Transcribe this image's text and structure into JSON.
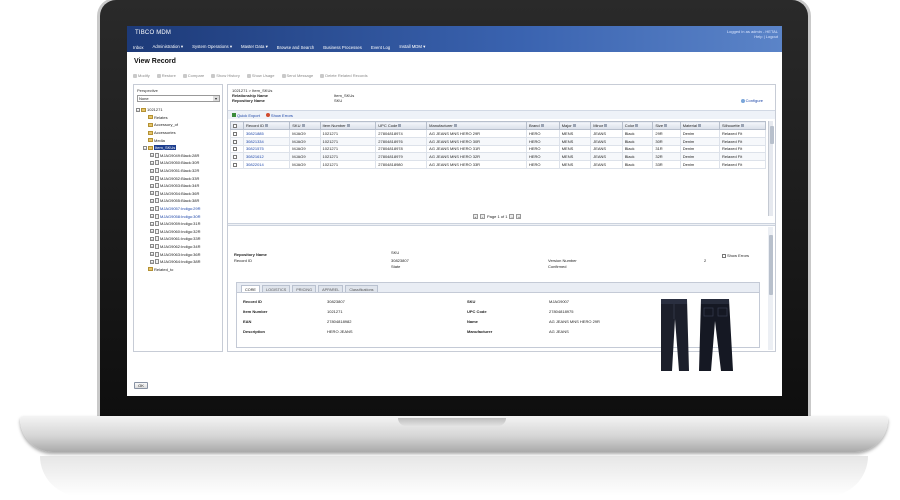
{
  "app": {
    "brand": "TIBCO MDM",
    "user_line1": "Logged in as admin - HETAL",
    "user_line2": "Help | Logout",
    "menu": [
      "Inbox",
      "Administration ▾",
      "System Operations ▾",
      "Master Data ▾",
      "Browse and Search",
      "Business Processes",
      "Event Log",
      "Install MDM ▾"
    ]
  },
  "page": {
    "title": "View Record",
    "toolbar": [
      "Modify",
      "Restore",
      "Compare",
      "Show History",
      "Show Usage",
      "Send Message",
      "Delete Related Records"
    ]
  },
  "perspective": {
    "label": "Perspective",
    "value": "None",
    "tree": [
      {
        "label": "1021271",
        "level": 0,
        "kind": "root",
        "toggle": "−"
      },
      {
        "label": "Relates",
        "level": 1,
        "kind": "folder",
        "toggle": ""
      },
      {
        "label": "Accessory_of",
        "level": 1,
        "kind": "folder",
        "toggle": ""
      },
      {
        "label": "Accessories",
        "level": 1,
        "kind": "folder",
        "toggle": ""
      },
      {
        "label": "Media",
        "level": 1,
        "kind": "folder",
        "toggle": ""
      },
      {
        "label": "Item_SKUs",
        "level": 1,
        "kind": "folder",
        "toggle": "−",
        "selected": true
      },
      {
        "label": "MJAG9049:Black:28R",
        "level": 2,
        "kind": "doc",
        "toggle": "+"
      },
      {
        "label": "MJAG9050:Black:30R",
        "level": 2,
        "kind": "doc",
        "toggle": "+"
      },
      {
        "label": "MJAG9051:Black:32R",
        "level": 2,
        "kind": "doc",
        "toggle": "+"
      },
      {
        "label": "MJAG9052:Black:33R",
        "level": 2,
        "kind": "doc",
        "toggle": "+"
      },
      {
        "label": "MJAG9053:Black:34R",
        "level": 2,
        "kind": "doc",
        "toggle": "+"
      },
      {
        "label": "MJAG9054:Black:36R",
        "level": 2,
        "kind": "doc",
        "toggle": "+"
      },
      {
        "label": "MJAG9055:Black:38R",
        "level": 2,
        "kind": "doc",
        "toggle": "+"
      },
      {
        "label": "MJAG9057:Indigo:29R",
        "level": 2,
        "kind": "doc",
        "toggle": "+",
        "link": true
      },
      {
        "label": "MJAG9058:Indigo:30R",
        "level": 2,
        "kind": "doc",
        "toggle": "+",
        "link": true
      },
      {
        "label": "MJAG9059:Indigo:31R",
        "level": 2,
        "kind": "doc",
        "toggle": "+"
      },
      {
        "label": "MJAG9060:Indigo:32R",
        "level": 2,
        "kind": "doc",
        "toggle": "+"
      },
      {
        "label": "MJAG9061:Indigo:33R",
        "level": 2,
        "kind": "doc",
        "toggle": "+"
      },
      {
        "label": "MJAG9062:Indigo:34R",
        "level": 2,
        "kind": "doc",
        "toggle": "+"
      },
      {
        "label": "MJAG9063:Indigo:36R",
        "level": 2,
        "kind": "doc",
        "toggle": "+"
      },
      {
        "label": "MJAG9064:Indigo:38R",
        "level": 2,
        "kind": "doc",
        "toggle": "+"
      },
      {
        "label": "Related_to",
        "level": 1,
        "kind": "folder",
        "toggle": ""
      }
    ]
  },
  "record": {
    "path": "1021271 > Item_SKUs",
    "relationship_label": "Relationship Name",
    "relationship_value": "Item_SKUs",
    "repository_label": "Repository Name",
    "repository_value": "SKU",
    "configure": "Configure"
  },
  "grid": {
    "toolbar": [
      "Quick Export",
      "Show Errors"
    ],
    "columns": [
      "Record ID",
      "SKU",
      "Item Number",
      "UPC Code",
      "Manufacturer",
      "Brand",
      "Major",
      "Minor",
      "Color",
      "Size",
      "Material",
      "Silhouette"
    ],
    "rows": [
      [
        "30821885",
        "MJAG9",
        "1021271",
        "27804818974",
        "AG JEANS MNS HERO 29R",
        "HERO",
        "MENS",
        "JEANS",
        "Black",
        "29R",
        "Denim",
        "Relaxed Fit"
      ],
      [
        "30821334",
        "MJAG9",
        "1021271",
        "27804818976",
        "AG JEANS MNS HERO 30R",
        "HERO",
        "MENS",
        "JEANS",
        "Black",
        "30R",
        "Denim",
        "Relaxed Fit"
      ],
      [
        "30821575",
        "MJAG9",
        "1021271",
        "27804818978",
        "AG JEANS MNS HERO 31R",
        "HERO",
        "MENS",
        "JEANS",
        "Black",
        "31R",
        "Denim",
        "Relaxed Fit"
      ],
      [
        "30821612",
        "MJAG9",
        "1021271",
        "27804818979",
        "AG JEANS MNS HERO 32R",
        "HERO",
        "MENS",
        "JEANS",
        "Black",
        "32R",
        "Denim",
        "Relaxed Fit"
      ],
      [
        "30822014",
        "MJAG9",
        "1021271",
        "27804818980",
        "AG JEANS MNS HERO 33R",
        "HERO",
        "MENS",
        "JEANS",
        "Black",
        "33R",
        "Denim",
        "Relaxed Fit"
      ]
    ],
    "pager": "Page 1 of 1"
  },
  "detail": {
    "repository_label": "Repository Name",
    "repository_value": "SKU",
    "record_id_label": "Record ID",
    "record_id_value": "30823807",
    "state_label": "State",
    "state_value": "Confirmed",
    "version_label": "Version Number",
    "version_value": "2",
    "show_errors": "Show Errors",
    "tabs": [
      "CORE",
      "LOGISTICS",
      "PRICING",
      "APPAREL",
      "Classifications"
    ],
    "left_attrs": [
      {
        "k": "Record ID",
        "v": "30823807"
      },
      {
        "k": "Item Number",
        "v": "1021271"
      },
      {
        "k": "EAN",
        "v": "27804818982"
      },
      {
        "k": "Description",
        "v": "HERO JEANS"
      }
    ],
    "right_attrs": [
      {
        "k": "SKU",
        "v": "MJAG9007"
      },
      {
        "k": "UPC Code",
        "v": "27804818975"
      },
      {
        "k": "Name",
        "v": "AG JEANS MNS HERO 29R"
      },
      {
        "k": "Manufacturer",
        "v": "AG JEANS"
      }
    ]
  },
  "footer": {
    "ok": "OK"
  },
  "colors": {
    "header_start": "#1d3a78",
    "header_end": "#5b84c8",
    "selected": "#1d3e8f",
    "link": "#1d46a8"
  }
}
